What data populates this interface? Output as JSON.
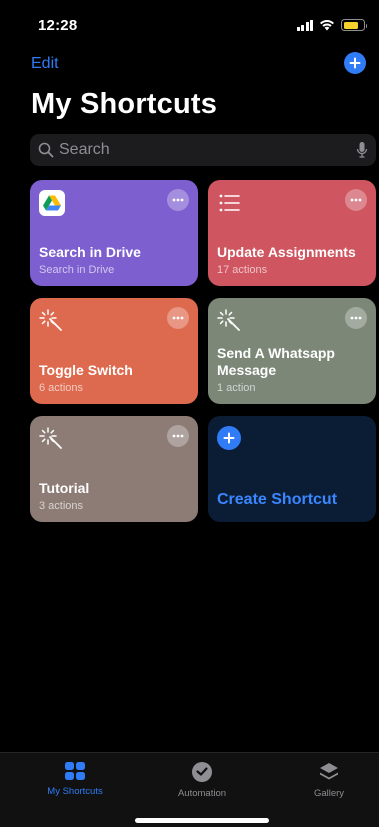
{
  "status_bar": {
    "time": "12:28",
    "battery_level": 0.75,
    "battery_color": "#f7d22c"
  },
  "header": {
    "edit_label": "Edit",
    "add_icon": "plus-icon",
    "title": "My Shortcuts"
  },
  "search": {
    "placeholder": "Search",
    "value": "",
    "search_icon": "magnifier-icon",
    "mic_icon": "microphone-icon"
  },
  "accent_color": "#2f7cf6",
  "shortcuts": [
    {
      "title": "Search in Drive",
      "subtitle": "Search in Drive",
      "color": "#7d5fd0",
      "icon": "google-drive-icon"
    },
    {
      "title": "Update Assignments",
      "subtitle": "17 actions",
      "color": "#cf5560",
      "icon": "list-icon"
    },
    {
      "title": "Toggle Switch",
      "subtitle": "6 actions",
      "color": "#dd6a4f",
      "icon": "magic-wand-icon"
    },
    {
      "title": "Send A Whatsapp Message",
      "subtitle": "1 action",
      "color": "#7c8778",
      "icon": "magic-wand-icon"
    },
    {
      "title": "Tutorial",
      "subtitle": "3 actions",
      "color": "#8d7c76",
      "icon": "magic-wand-icon"
    }
  ],
  "create_shortcut": {
    "label": "Create Shortcut",
    "icon": "plus-icon"
  },
  "tabs": [
    {
      "label": "My Shortcuts",
      "icon": "grid-icon",
      "active": true
    },
    {
      "label": "Automation",
      "icon": "clock-check-icon",
      "active": false
    },
    {
      "label": "Gallery",
      "icon": "layers-icon",
      "active": false
    }
  ]
}
